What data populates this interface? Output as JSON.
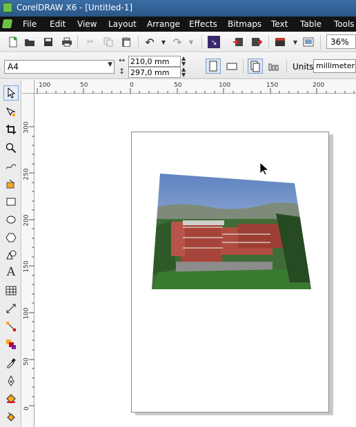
{
  "window": {
    "title": "CorelDRAW X6 - [Untitled-1]"
  },
  "menu": [
    "File",
    "Edit",
    "View",
    "Layout",
    "Arrange",
    "Effects",
    "Bitmaps",
    "Text",
    "Table",
    "Tools"
  ],
  "toolbar": {
    "zoom": "36%"
  },
  "property_bar": {
    "paper_size": "A4",
    "width": "210,0 mm",
    "height": "297,0 mm",
    "units_label": "Units:",
    "units_value": "millimeters"
  },
  "ruler_h": [
    "100",
    "50",
    "0",
    "50",
    "100",
    "150",
    "200"
  ],
  "ruler_v": [
    "300",
    "250",
    "200",
    "150",
    "100",
    "50",
    "0"
  ],
  "colors": {
    "titlebar": "#2f5f92",
    "menubar": "#141414",
    "accent_green": "#6cc24a"
  }
}
